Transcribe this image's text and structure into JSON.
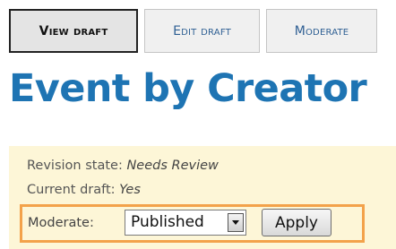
{
  "tabs": [
    {
      "label": "View draft",
      "active": true
    },
    {
      "label": "Edit draft",
      "active": false
    },
    {
      "label": "Moderate",
      "active": false
    }
  ],
  "page_title": "Event by Creator",
  "info": {
    "revision_state_label": "Revision state:",
    "revision_state_value": "Needs Review",
    "current_draft_label": "Current draft:",
    "current_draft_value": "Yes"
  },
  "moderate": {
    "label": "Moderate:",
    "selected": "Published",
    "apply_label": "Apply"
  },
  "colors": {
    "title": "#1e74b3",
    "tab_link": "#2e5f93",
    "panel_bg": "#fdf6d7",
    "highlight_border": "#f3a24a"
  }
}
